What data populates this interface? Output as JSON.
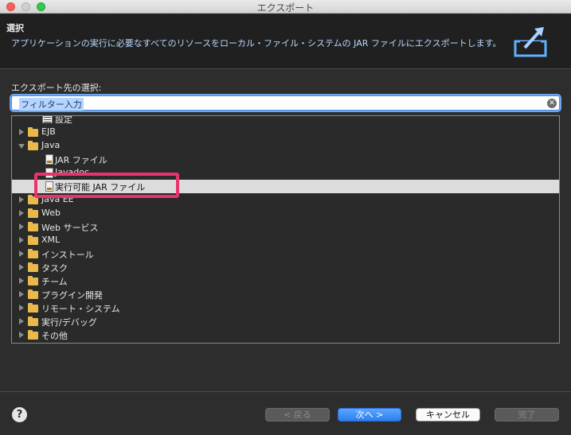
{
  "window": {
    "title": "エクスポート"
  },
  "header": {
    "title": "選択",
    "description": "アプリケーションの実行に必要なすべてのリソースをローカル・ファイル・システムの JAR ファイルにエクスポートします。",
    "icon": "export-wizard-icon"
  },
  "section_label": "エクスポート先の選択:",
  "filter": {
    "value": "フィルター入力"
  },
  "tree": {
    "items": [
      {
        "label": "設定",
        "icon": "settings-icon",
        "expand": "none"
      },
      {
        "label": "EJB",
        "icon": "folder-icon",
        "expand": "collapsed"
      },
      {
        "label": "Java",
        "icon": "folder-icon",
        "expand": "expanded"
      },
      {
        "label": "JAR ファイル",
        "icon": "jar-file-icon",
        "expand": "none"
      },
      {
        "label": "Javadoc",
        "icon": "javadoc-icon",
        "expand": "none"
      },
      {
        "label": "実行可能 JAR ファイル",
        "icon": "runnable-jar-icon",
        "expand": "none",
        "selected": true
      },
      {
        "label": "Java EE",
        "icon": "folder-icon",
        "expand": "collapsed"
      },
      {
        "label": "Web",
        "icon": "folder-icon",
        "expand": "collapsed"
      },
      {
        "label": "Web サービス",
        "icon": "folder-icon",
        "expand": "collapsed"
      },
      {
        "label": "XML",
        "icon": "folder-icon",
        "expand": "collapsed"
      },
      {
        "label": "インストール",
        "icon": "folder-icon",
        "expand": "collapsed"
      },
      {
        "label": "タスク",
        "icon": "folder-icon",
        "expand": "collapsed"
      },
      {
        "label": "チーム",
        "icon": "folder-icon",
        "expand": "collapsed"
      },
      {
        "label": "プラグイン開発",
        "icon": "folder-icon",
        "expand": "collapsed"
      },
      {
        "label": "リモート・システム",
        "icon": "folder-icon",
        "expand": "collapsed"
      },
      {
        "label": "実行/デバッグ",
        "icon": "folder-icon",
        "expand": "collapsed"
      },
      {
        "label": "その他",
        "icon": "folder-icon",
        "expand": "collapsed"
      }
    ]
  },
  "buttons": {
    "help": "?",
    "back": "< 戻る",
    "next": "次へ >",
    "cancel": "キャンセル",
    "finish": "完了"
  },
  "colors": {
    "accent": "#2d7ef0",
    "highlight_box": "#e8336b",
    "description_text": "#b8d8ff"
  }
}
